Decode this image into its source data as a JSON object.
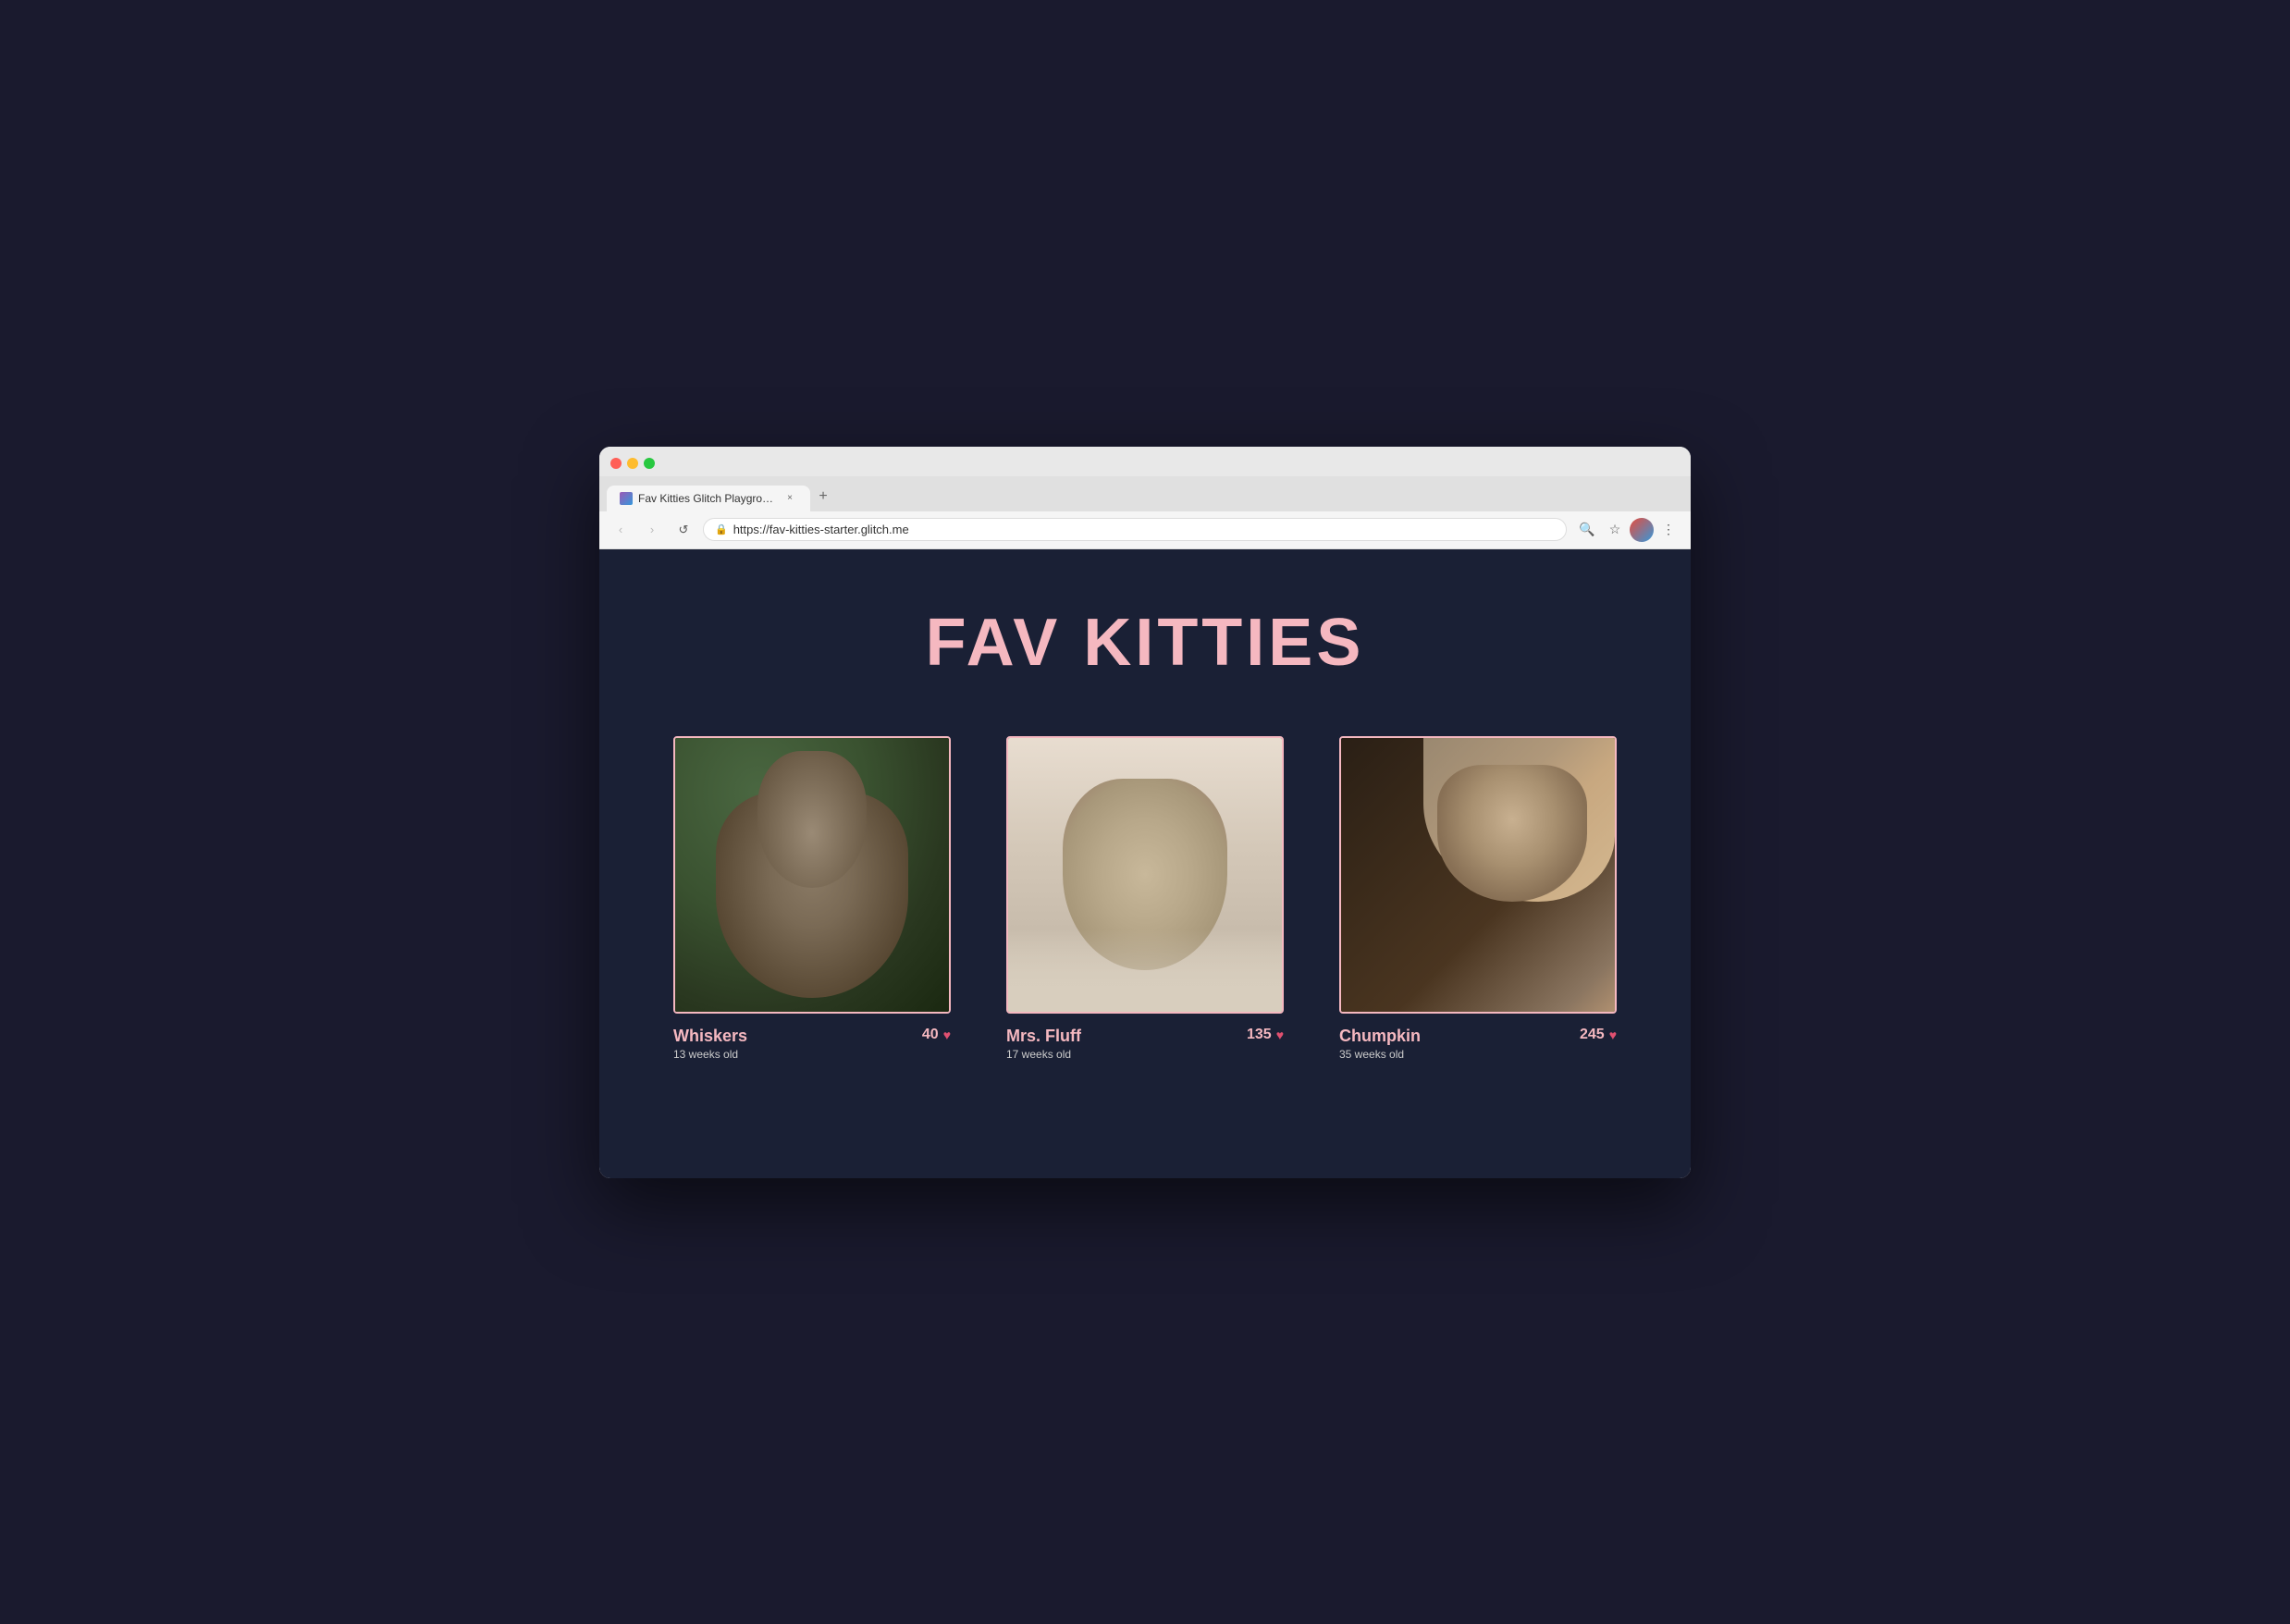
{
  "browser": {
    "tab_title": "Fav Kitties Glitch Playground",
    "tab_close_label": "×",
    "new_tab_label": "+",
    "url": "https://fav-kitties-starter.glitch.me",
    "nav": {
      "back_label": "‹",
      "forward_label": "›",
      "reload_label": "↺"
    },
    "toolbar": {
      "search_label": "🔍",
      "bookmark_label": "☆",
      "menu_label": "⋮"
    }
  },
  "page": {
    "title": "FAV KITTIES",
    "background_color": "#1a2035",
    "accent_color": "#f5b8c0",
    "cats": [
      {
        "id": "whiskers",
        "name": "Whiskers",
        "age": "13 weeks old",
        "likes": 40
      },
      {
        "id": "mrs-fluff",
        "name": "Mrs. Fluff",
        "age": "17 weeks old",
        "likes": 135
      },
      {
        "id": "chumpkin",
        "name": "Chumpkin",
        "age": "35 weeks old",
        "likes": 245
      }
    ]
  }
}
